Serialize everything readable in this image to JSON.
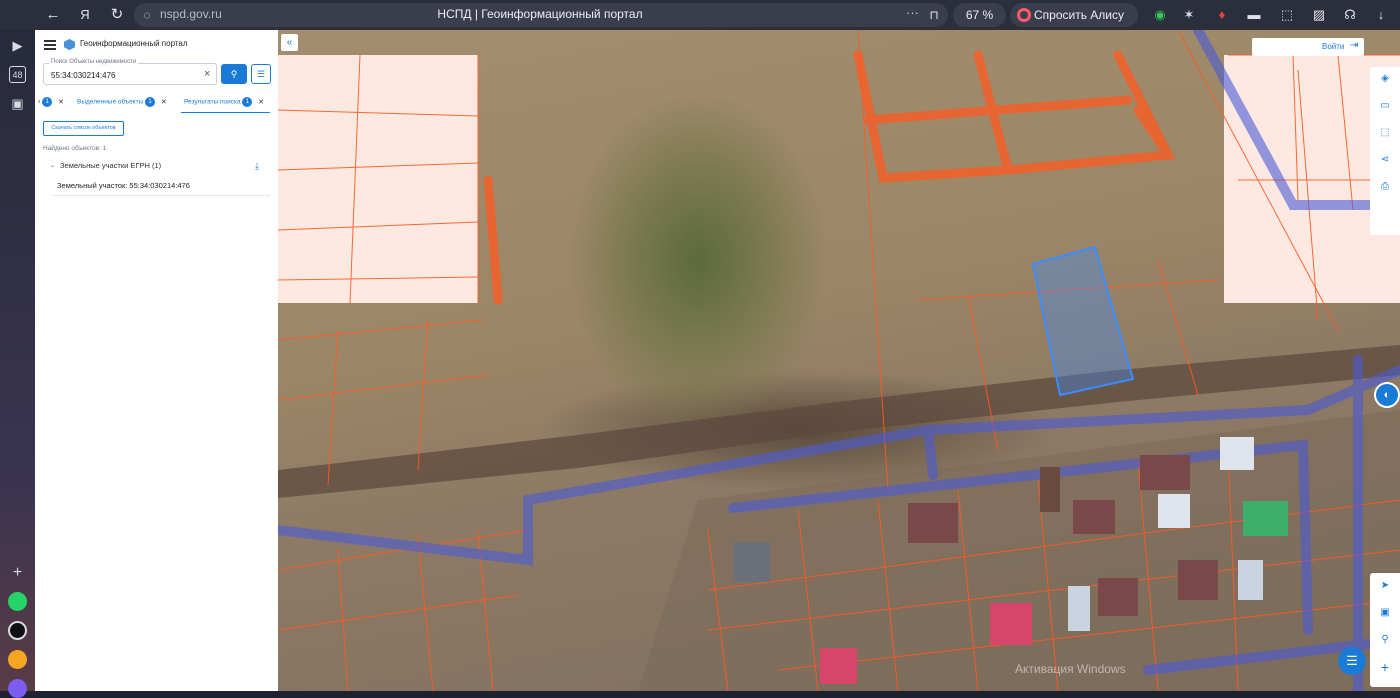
{
  "browser": {
    "url": "nspd.gov.ru",
    "title": "НСПД | Геоинформационный портал",
    "zoom": "67 %",
    "alice_label": "Спросить Алису AI"
  },
  "rail": {
    "badge": "48"
  },
  "panel": {
    "portal_title": "Геоинформационный портал",
    "search_legend": "Поиск Объекты недвижимости",
    "search_value": "55:34:030214:476",
    "tabs": [
      {
        "label": "",
        "badge": "1"
      },
      {
        "label": "Выделенные объекты",
        "badge": "1"
      },
      {
        "label": "Результаты поиска",
        "badge": "1"
      }
    ],
    "download_label": "Скачать список объектов",
    "found_text": "Найдено объектов: 1",
    "group_label": "Земельные участки ЕГРН (1)",
    "result_item": "Земельный участок: 55:34:030214:476"
  },
  "map": {
    "login_label": "Войти",
    "watermark": "Активация Windows"
  },
  "colors": {
    "accent": "#1a7bd6",
    "parcel_line": "#ff5a1f",
    "selected_parcel": "#3b8cff",
    "zone_band": "#4a5bd6",
    "overlay_fill": "#fde9e2"
  }
}
